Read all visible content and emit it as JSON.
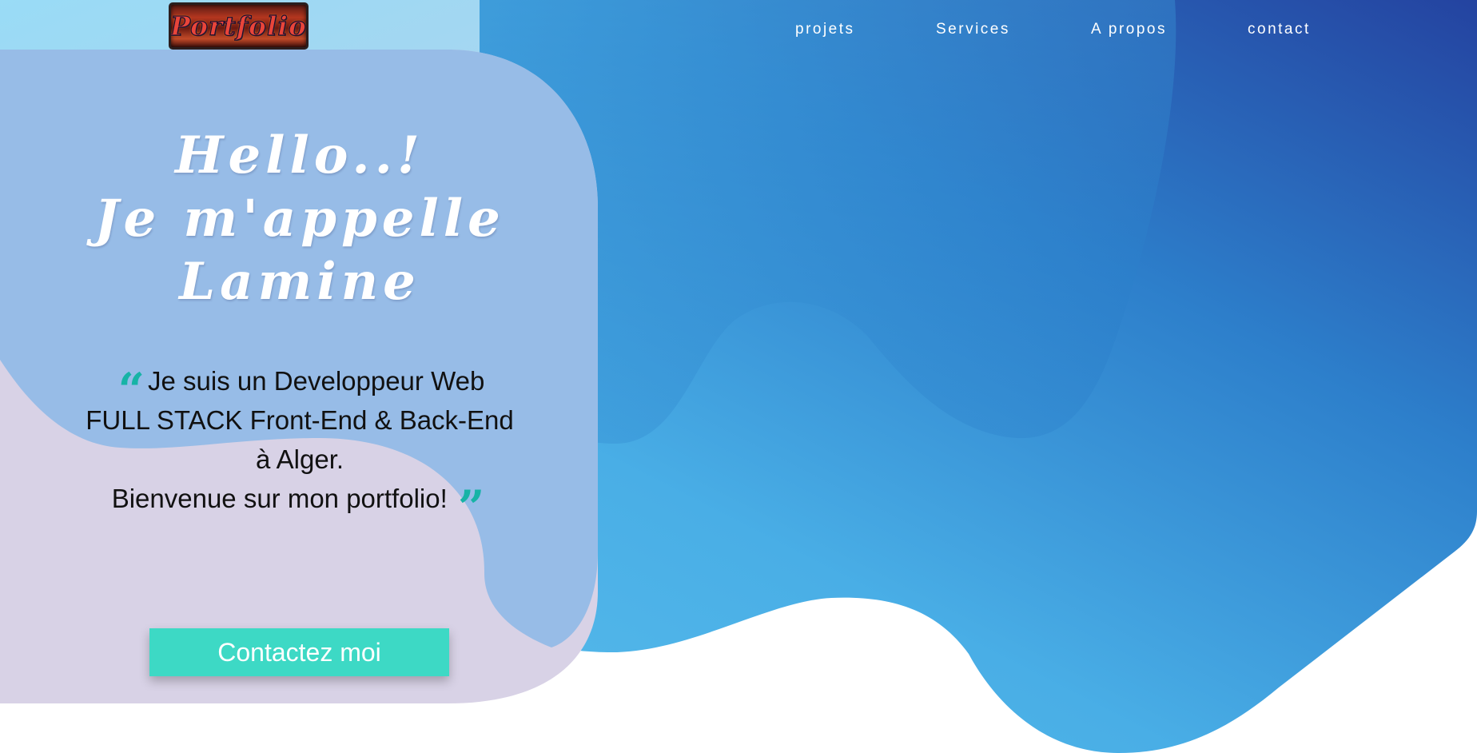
{
  "header": {
    "logo_text": "Portfolio",
    "nav": [
      {
        "label": "projets"
      },
      {
        "label": "Services"
      },
      {
        "label": "A propos"
      },
      {
        "label": "contact"
      }
    ]
  },
  "hero": {
    "title_line1": "Hello..!",
    "title_line2": "Je m'appelle",
    "title_line3": "Lamine",
    "desc_line1": "Je suis un Developpeur Web",
    "desc_line2": "FULL STACK Front-End & Back-End",
    "desc_line3": "à Alger.",
    "desc_line4": "Bienvenue sur mon portfolio!",
    "open_quote_glyph": "“",
    "close_quote_glyph": "”",
    "cta_label": "Contactez moi"
  },
  "colors": {
    "gradient_light": "#5ec3ee",
    "gradient_dark": "#2443a0",
    "card_overlay": "#d8d2e6",
    "quote_icon": "#17b3a6",
    "cta_button": "#3dd9c5"
  },
  "icons": {
    "open_quote": "open-quote-icon",
    "close_quote": "close-quote-icon"
  }
}
